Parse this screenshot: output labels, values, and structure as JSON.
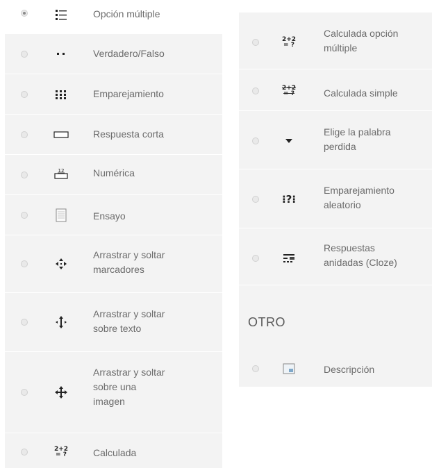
{
  "left_column": {
    "items": [
      {
        "label": "Opción múltiple",
        "icon": "multiple-choice-icon",
        "selected": true
      },
      {
        "label": "Verdadero/Falso",
        "icon": "true-false-icon",
        "selected": false
      },
      {
        "label": "Emparejamiento",
        "icon": "matching-icon",
        "selected": false
      },
      {
        "label": "Respuesta corta",
        "icon": "short-answer-icon",
        "selected": false
      },
      {
        "label": "Numérica",
        "icon": "numerical-icon",
        "selected": false
      },
      {
        "label": "Ensayo",
        "icon": "essay-icon",
        "selected": false
      },
      {
        "label": "Arrastrar y soltar\nmarcadores",
        "icon": "drag-drop-markers-icon",
        "selected": false
      },
      {
        "label": "Arrastrar y soltar\nsobre texto",
        "icon": "drag-drop-text-icon",
        "selected": false
      },
      {
        "label": "Arrastrar y soltar\nsobre una\nimagen",
        "icon": "drag-drop-image-icon",
        "selected": false
      },
      {
        "label": "Calculada",
        "icon": "calculated-icon",
        "selected": false
      }
    ]
  },
  "right_column": {
    "items": [
      {
        "label": "Calculada opción\nmúltiple",
        "icon": "calculated-multichoice-icon",
        "selected": false
      },
      {
        "label": "Calculada simple",
        "icon": "calculated-simple-icon",
        "selected": false
      },
      {
        "label": "Elige la palabra\nperdida",
        "icon": "select-missing-words-icon",
        "selected": false
      },
      {
        "label": "Emparejamiento\naleatorio",
        "icon": "random-matching-icon",
        "selected": false
      },
      {
        "label": "Respuestas\nanidadas (Cloze)",
        "icon": "embedded-answers-icon",
        "selected": false
      }
    ],
    "section_title": "OTRO",
    "other_items": [
      {
        "label": "Descripción",
        "icon": "description-icon",
        "selected": false
      }
    ]
  },
  "icon_text": {
    "fraction_top": "2+2",
    "fraction_bottom": "= ?",
    "numeric_badge": "12",
    "random_matching": "⁝?⁝"
  }
}
